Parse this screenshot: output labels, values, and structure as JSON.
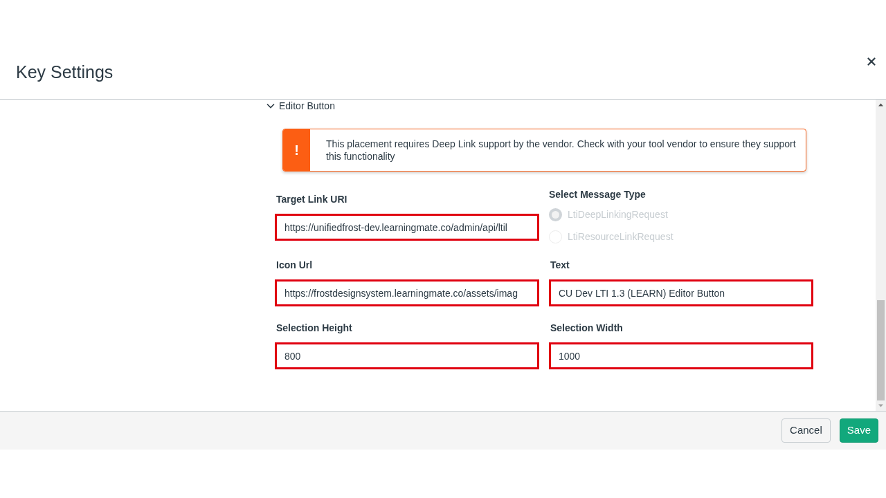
{
  "dialog": {
    "title": "Key Settings"
  },
  "section": {
    "title": "Editor Button",
    "expanded": true
  },
  "alert": {
    "kind": "warning",
    "icon": "!",
    "message": "This placement requires Deep Link support by the vendor. Check with your tool vendor to ensure they support this functionality"
  },
  "fields": [
    {
      "kind": "text",
      "label": "Target Link URI",
      "value": "https://unifiedfrost-dev.learningmate.co/admin/api/ltil",
      "highlighted": true
    },
    {
      "kind": "radio",
      "label": "Select Message Type",
      "disabled": true,
      "options": [
        {
          "label": "LtiDeepLinkingRequest",
          "selected": true
        },
        {
          "label": "LtiResourceLinkRequest",
          "selected": false
        }
      ]
    },
    {
      "kind": "text",
      "label": "Icon Url",
      "value": "https://frostdesignsystem.learningmate.co/assets/imag",
      "highlighted": true
    },
    {
      "kind": "text",
      "label": "Text",
      "value": "CU Dev LTI 1.3 (LEARN) Editor Button",
      "highlighted": true
    },
    {
      "kind": "text",
      "label": "Selection Height",
      "value": "800",
      "highlighted": true
    },
    {
      "kind": "text",
      "label": "Selection Width",
      "value": "1000",
      "highlighted": true
    }
  ],
  "buttons": [
    {
      "kind": "secondary",
      "label": "Cancel"
    },
    {
      "kind": "primary",
      "label": "Save"
    }
  ]
}
